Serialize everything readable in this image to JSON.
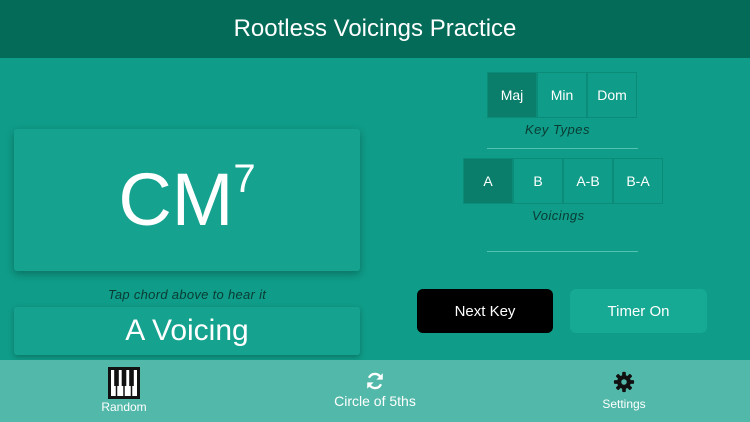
{
  "header": {
    "title": "Rootless Voicings Practice"
  },
  "chord": {
    "base": "CM",
    "superscript": "7",
    "hint": "Tap chord above to hear it"
  },
  "voicing_display": "A Voicing",
  "key_types": {
    "label": "Key Types",
    "options": [
      "Maj",
      "Min",
      "Dom"
    ],
    "selected": "Maj"
  },
  "voicings": {
    "label": "Voicings",
    "options": [
      "A",
      "B",
      "A-B",
      "B-A"
    ],
    "selected": "A"
  },
  "buttons": {
    "next_key": "Next Key",
    "timer": "Timer On"
  },
  "tabs": [
    {
      "label": "Random",
      "icon": "piano-icon"
    },
    {
      "label": "Circle of 5ths",
      "icon": "refresh-icon"
    },
    {
      "label": "Settings",
      "icon": "gear-icon"
    }
  ],
  "colors": {
    "header": "#046b58",
    "background": "#0f9c88",
    "tabbar": "#52b8a9",
    "next_button": "#000000"
  }
}
